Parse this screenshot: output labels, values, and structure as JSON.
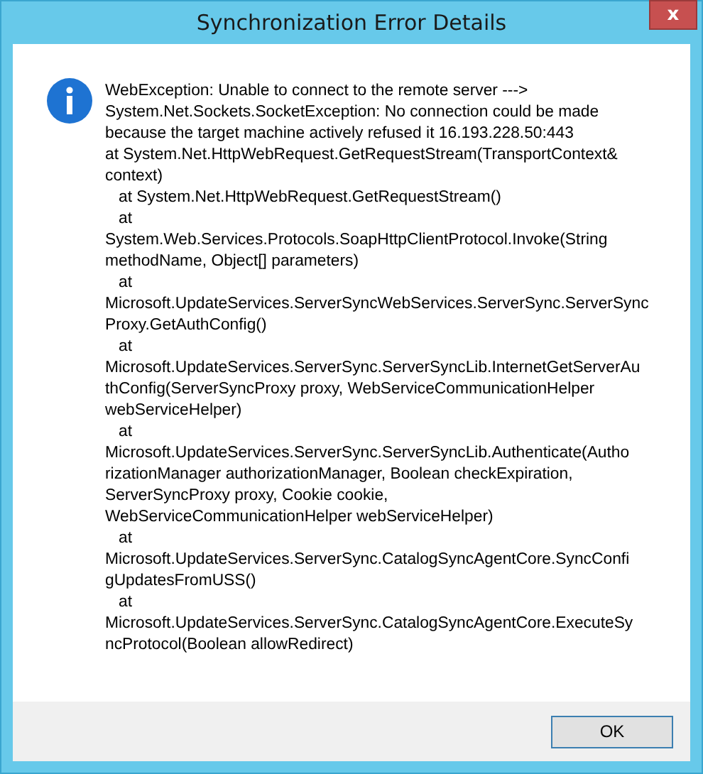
{
  "window": {
    "title": "Synchronization Error Details",
    "close_glyph": "x"
  },
  "message": {
    "lines": [
      "WebException: Unable to connect to the remote server --->",
      "System.Net.Sockets.SocketException: No connection could be made",
      "because the target machine actively refused it 16.193.228.50:443",
      "at System.Net.HttpWebRequest.GetRequestStream(TransportContext&",
      "context)",
      "   at System.Net.HttpWebRequest.GetRequestStream()",
      "   at",
      "System.Web.Services.Protocols.SoapHttpClientProtocol.Invoke(String",
      "methodName, Object[] parameters)",
      "   at",
      "Microsoft.UpdateServices.ServerSyncWebServices.ServerSync.ServerSync",
      "Proxy.GetAuthConfig()",
      "   at",
      "Microsoft.UpdateServices.ServerSync.ServerSyncLib.InternetGetServerAu",
      "thConfig(ServerSyncProxy proxy, WebServiceCommunicationHelper",
      "webServiceHelper)",
      "   at",
      "Microsoft.UpdateServices.ServerSync.ServerSyncLib.Authenticate(Autho",
      "rizationManager authorizationManager, Boolean checkExpiration,",
      "ServerSyncProxy proxy, Cookie cookie,",
      "WebServiceCommunicationHelper webServiceHelper)",
      "   at",
      "Microsoft.UpdateServices.ServerSync.CatalogSyncAgentCore.SyncConfi",
      "gUpdatesFromUSS()",
      "   at",
      "Microsoft.UpdateServices.ServerSync.CatalogSyncAgentCore.ExecuteSy",
      "ncProtocol(Boolean allowRedirect)"
    ]
  },
  "buttons": [
    {
      "label": "OK"
    }
  ]
}
